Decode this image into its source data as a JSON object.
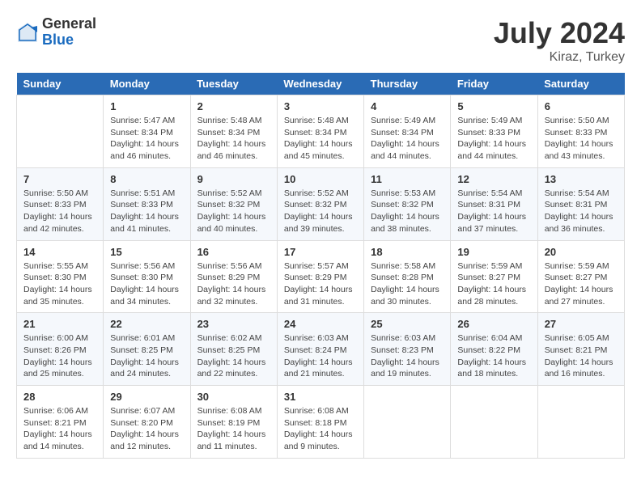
{
  "header": {
    "logo_general": "General",
    "logo_blue": "Blue",
    "title": "July 2024",
    "location": "Kiraz, Turkey"
  },
  "columns": [
    "Sunday",
    "Monday",
    "Tuesday",
    "Wednesday",
    "Thursday",
    "Friday",
    "Saturday"
  ],
  "weeks": [
    [
      {
        "day": "",
        "sunrise": "",
        "sunset": "",
        "daylight": ""
      },
      {
        "day": "1",
        "sunrise": "Sunrise: 5:47 AM",
        "sunset": "Sunset: 8:34 PM",
        "daylight": "Daylight: 14 hours and 46 minutes."
      },
      {
        "day": "2",
        "sunrise": "Sunrise: 5:48 AM",
        "sunset": "Sunset: 8:34 PM",
        "daylight": "Daylight: 14 hours and 46 minutes."
      },
      {
        "day": "3",
        "sunrise": "Sunrise: 5:48 AM",
        "sunset": "Sunset: 8:34 PM",
        "daylight": "Daylight: 14 hours and 45 minutes."
      },
      {
        "day": "4",
        "sunrise": "Sunrise: 5:49 AM",
        "sunset": "Sunset: 8:34 PM",
        "daylight": "Daylight: 14 hours and 44 minutes."
      },
      {
        "day": "5",
        "sunrise": "Sunrise: 5:49 AM",
        "sunset": "Sunset: 8:33 PM",
        "daylight": "Daylight: 14 hours and 44 minutes."
      },
      {
        "day": "6",
        "sunrise": "Sunrise: 5:50 AM",
        "sunset": "Sunset: 8:33 PM",
        "daylight": "Daylight: 14 hours and 43 minutes."
      }
    ],
    [
      {
        "day": "7",
        "sunrise": "Sunrise: 5:50 AM",
        "sunset": "Sunset: 8:33 PM",
        "daylight": "Daylight: 14 hours and 42 minutes."
      },
      {
        "day": "8",
        "sunrise": "Sunrise: 5:51 AM",
        "sunset": "Sunset: 8:33 PM",
        "daylight": "Daylight: 14 hours and 41 minutes."
      },
      {
        "day": "9",
        "sunrise": "Sunrise: 5:52 AM",
        "sunset": "Sunset: 8:32 PM",
        "daylight": "Daylight: 14 hours and 40 minutes."
      },
      {
        "day": "10",
        "sunrise": "Sunrise: 5:52 AM",
        "sunset": "Sunset: 8:32 PM",
        "daylight": "Daylight: 14 hours and 39 minutes."
      },
      {
        "day": "11",
        "sunrise": "Sunrise: 5:53 AM",
        "sunset": "Sunset: 8:32 PM",
        "daylight": "Daylight: 14 hours and 38 minutes."
      },
      {
        "day": "12",
        "sunrise": "Sunrise: 5:54 AM",
        "sunset": "Sunset: 8:31 PM",
        "daylight": "Daylight: 14 hours and 37 minutes."
      },
      {
        "day": "13",
        "sunrise": "Sunrise: 5:54 AM",
        "sunset": "Sunset: 8:31 PM",
        "daylight": "Daylight: 14 hours and 36 minutes."
      }
    ],
    [
      {
        "day": "14",
        "sunrise": "Sunrise: 5:55 AM",
        "sunset": "Sunset: 8:30 PM",
        "daylight": "Daylight: 14 hours and 35 minutes."
      },
      {
        "day": "15",
        "sunrise": "Sunrise: 5:56 AM",
        "sunset": "Sunset: 8:30 PM",
        "daylight": "Daylight: 14 hours and 34 minutes."
      },
      {
        "day": "16",
        "sunrise": "Sunrise: 5:56 AM",
        "sunset": "Sunset: 8:29 PM",
        "daylight": "Daylight: 14 hours and 32 minutes."
      },
      {
        "day": "17",
        "sunrise": "Sunrise: 5:57 AM",
        "sunset": "Sunset: 8:29 PM",
        "daylight": "Daylight: 14 hours and 31 minutes."
      },
      {
        "day": "18",
        "sunrise": "Sunrise: 5:58 AM",
        "sunset": "Sunset: 8:28 PM",
        "daylight": "Daylight: 14 hours and 30 minutes."
      },
      {
        "day": "19",
        "sunrise": "Sunrise: 5:59 AM",
        "sunset": "Sunset: 8:27 PM",
        "daylight": "Daylight: 14 hours and 28 minutes."
      },
      {
        "day": "20",
        "sunrise": "Sunrise: 5:59 AM",
        "sunset": "Sunset: 8:27 PM",
        "daylight": "Daylight: 14 hours and 27 minutes."
      }
    ],
    [
      {
        "day": "21",
        "sunrise": "Sunrise: 6:00 AM",
        "sunset": "Sunset: 8:26 PM",
        "daylight": "Daylight: 14 hours and 25 minutes."
      },
      {
        "day": "22",
        "sunrise": "Sunrise: 6:01 AM",
        "sunset": "Sunset: 8:25 PM",
        "daylight": "Daylight: 14 hours and 24 minutes."
      },
      {
        "day": "23",
        "sunrise": "Sunrise: 6:02 AM",
        "sunset": "Sunset: 8:25 PM",
        "daylight": "Daylight: 14 hours and 22 minutes."
      },
      {
        "day": "24",
        "sunrise": "Sunrise: 6:03 AM",
        "sunset": "Sunset: 8:24 PM",
        "daylight": "Daylight: 14 hours and 21 minutes."
      },
      {
        "day": "25",
        "sunrise": "Sunrise: 6:03 AM",
        "sunset": "Sunset: 8:23 PM",
        "daylight": "Daylight: 14 hours and 19 minutes."
      },
      {
        "day": "26",
        "sunrise": "Sunrise: 6:04 AM",
        "sunset": "Sunset: 8:22 PM",
        "daylight": "Daylight: 14 hours and 18 minutes."
      },
      {
        "day": "27",
        "sunrise": "Sunrise: 6:05 AM",
        "sunset": "Sunset: 8:21 PM",
        "daylight": "Daylight: 14 hours and 16 minutes."
      }
    ],
    [
      {
        "day": "28",
        "sunrise": "Sunrise: 6:06 AM",
        "sunset": "Sunset: 8:21 PM",
        "daylight": "Daylight: 14 hours and 14 minutes."
      },
      {
        "day": "29",
        "sunrise": "Sunrise: 6:07 AM",
        "sunset": "Sunset: 8:20 PM",
        "daylight": "Daylight: 14 hours and 12 minutes."
      },
      {
        "day": "30",
        "sunrise": "Sunrise: 6:08 AM",
        "sunset": "Sunset: 8:19 PM",
        "daylight": "Daylight: 14 hours and 11 minutes."
      },
      {
        "day": "31",
        "sunrise": "Sunrise: 6:08 AM",
        "sunset": "Sunset: 8:18 PM",
        "daylight": "Daylight: 14 hours and 9 minutes."
      },
      {
        "day": "",
        "sunrise": "",
        "sunset": "",
        "daylight": ""
      },
      {
        "day": "",
        "sunrise": "",
        "sunset": "",
        "daylight": ""
      },
      {
        "day": "",
        "sunrise": "",
        "sunset": "",
        "daylight": ""
      }
    ]
  ]
}
